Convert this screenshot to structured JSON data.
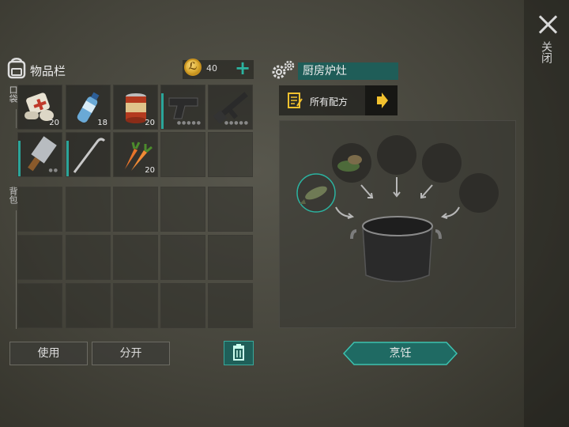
{
  "close_panel": {
    "label": "关闭"
  },
  "inventory": {
    "title": "物品栏",
    "coins": "40",
    "pocket_label": "口袋",
    "backpack_label": "背包",
    "pocket_slots": [
      {
        "item": "first-aid-kit",
        "count": "20"
      },
      {
        "item": "water-bottle",
        "count": "18"
      },
      {
        "item": "canned-food",
        "count": "20"
      },
      {
        "item": "pistol",
        "count": ""
      },
      {
        "item": "assault-rifle",
        "count": ""
      },
      {
        "item": "cleaver",
        "count": ""
      },
      {
        "item": "crowbar",
        "count": ""
      },
      {
        "item": "carrots",
        "count": "20"
      }
    ]
  },
  "buttons": {
    "use": "使用",
    "split": "分开"
  },
  "station": {
    "name": "厨房炉灶",
    "recipes_label": "所有配方",
    "cook_label": "烹饪",
    "ingredient_slots": [
      "fish",
      "herbs-greens",
      "empty",
      "empty",
      "empty"
    ]
  },
  "colors": {
    "accent": "#2bb3a0",
    "station_bg": "#1f5d58",
    "coin": "#d7a52b",
    "recipe_arrow": "#f2c12e"
  }
}
